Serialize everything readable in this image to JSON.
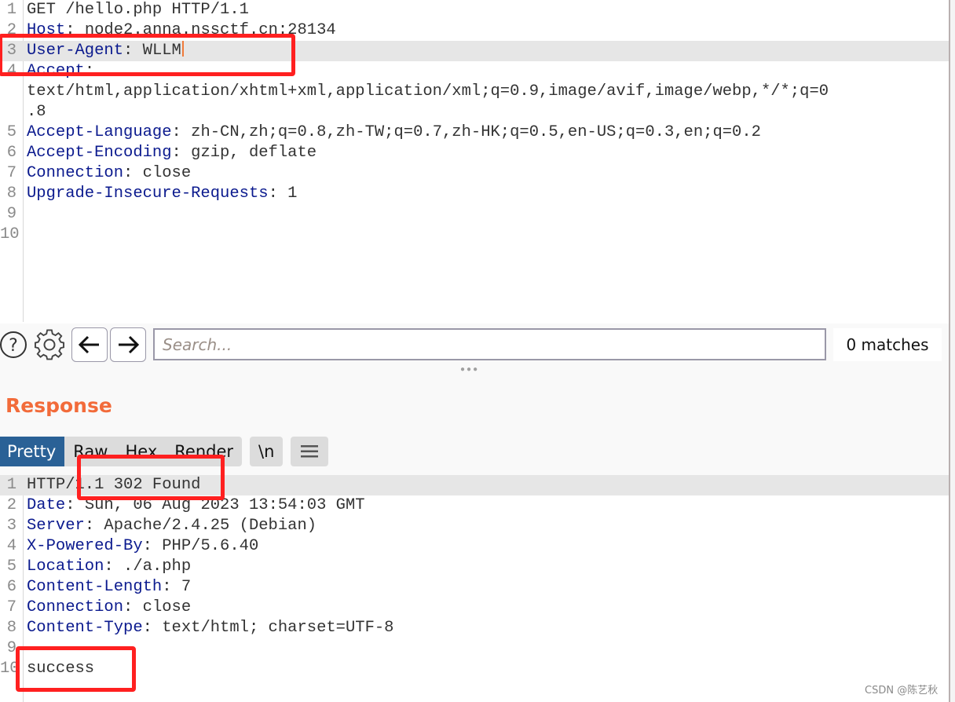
{
  "request": {
    "lines": [
      {
        "n": "1",
        "key": "",
        "text": "GET /hello.php HTTP/1.1"
      },
      {
        "n": "2",
        "key": "Host",
        "text": " node2.anna.nssctf.cn:28134"
      },
      {
        "n": "3",
        "key": "User-Agent",
        "text": " WLLM"
      },
      {
        "n": "4",
        "key": "Accept",
        "text": ""
      },
      {
        "n": "",
        "key": "",
        "text": "text/html,application/xhtml+xml,application/xml;q=0.9,image/avif,image/webp,*/*;q=0"
      },
      {
        "n": "",
        "key": "",
        "text": ".8"
      },
      {
        "n": "5",
        "key": "Accept-Language",
        "text": " zh-CN,zh;q=0.8,zh-TW;q=0.7,zh-HK;q=0.5,en-US;q=0.3,en;q=0.2"
      },
      {
        "n": "6",
        "key": "Accept-Encoding",
        "text": " gzip, deflate"
      },
      {
        "n": "7",
        "key": "Connection",
        "text": " close"
      },
      {
        "n": "8",
        "key": "Upgrade-Insecure-Requests",
        "text": " 1"
      },
      {
        "n": "9",
        "key": "",
        "text": ""
      },
      {
        "n": "10",
        "key": "",
        "text": ""
      }
    ],
    "highlighted_line": 3
  },
  "search_bar": {
    "help_icon": "question-circle-icon",
    "settings_icon": "gear-icon",
    "back_icon": "arrow-left-icon",
    "forward_icon": "arrow-right-icon",
    "placeholder": "Search...",
    "value": "",
    "matches": "0 matches"
  },
  "response": {
    "title": "Response",
    "tabs": [
      {
        "label": "Pretty",
        "active": true
      },
      {
        "label": "Raw",
        "active": false
      },
      {
        "label": "Hex",
        "active": false
      },
      {
        "label": "Render",
        "active": false
      }
    ],
    "newline_toggle": "\\n",
    "menu_icon": "hamburger-menu-icon",
    "lines": [
      {
        "n": "1",
        "key": "",
        "text": "HTTP/1.1 302 Found"
      },
      {
        "n": "2",
        "key": "Date",
        "text": " Sun, 06 Aug 2023 13:54:03 GMT"
      },
      {
        "n": "3",
        "key": "Server",
        "text": " Apache/2.4.25 (Debian)"
      },
      {
        "n": "4",
        "key": "X-Powered-By",
        "text": " PHP/5.6.40"
      },
      {
        "n": "5",
        "key": "Location",
        "text": " ./a.php"
      },
      {
        "n": "6",
        "key": "Content-Length",
        "text": " 7"
      },
      {
        "n": "7",
        "key": "Connection",
        "text": " close"
      },
      {
        "n": "8",
        "key": "Content-Type",
        "text": " text/html; charset=UTF-8"
      },
      {
        "n": "9",
        "key": "",
        "text": ""
      },
      {
        "n": "10",
        "key": "",
        "text": "success"
      }
    ],
    "highlighted_line": 1
  },
  "colors": {
    "header_key": "#0b1a8e",
    "response_title": "#f26b3a",
    "active_tab": "#2a6196",
    "annotation": "#ff2020"
  },
  "watermark": "CSDN @陈艺秋"
}
